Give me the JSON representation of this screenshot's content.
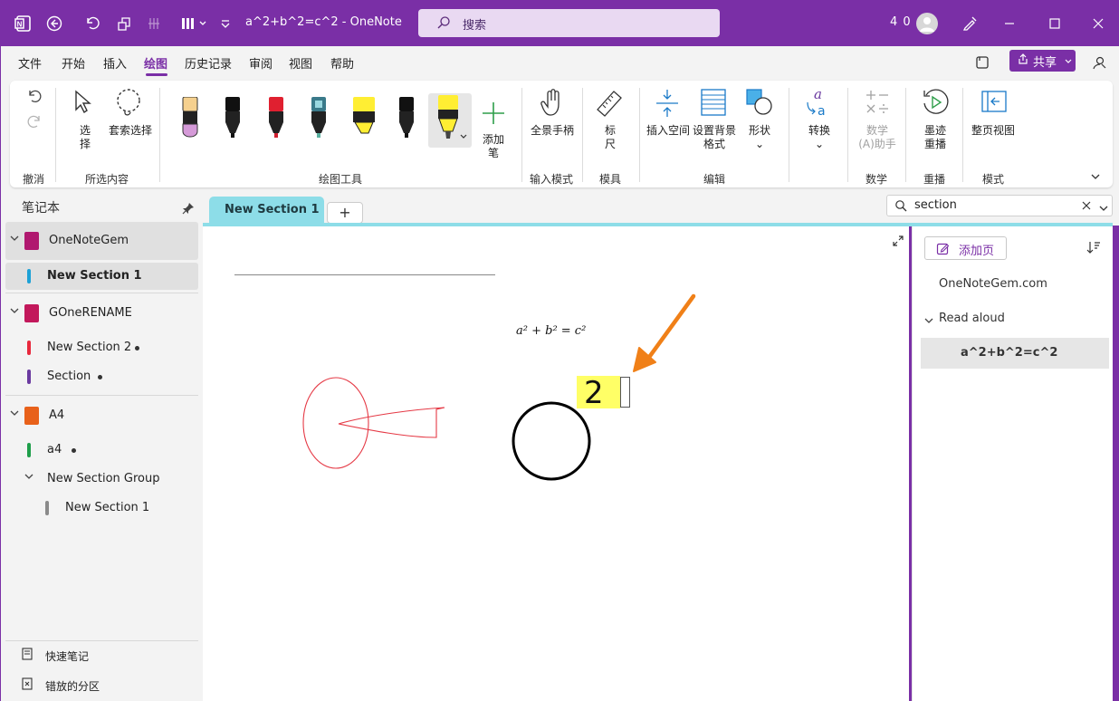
{
  "titlebar": {
    "doc_title": "a^2+b^2=c^2  -  OneNote",
    "search_placeholder": "搜索",
    "user_initials": "4 0"
  },
  "menu": {
    "items": [
      "文件",
      "开始",
      "插入",
      "绘图",
      "历史记录",
      "审阅",
      "视图",
      "帮助"
    ],
    "active": "绘图",
    "share_label": "共享"
  },
  "ribbon": {
    "undo_group": "撤消",
    "select_label": "选\n择",
    "lasso_label": "套索选择",
    "selection_group": "所选内容",
    "add_pen_label": "添加\n笔",
    "drawing_tools_group": "绘图工具",
    "hand_label": "全景手柄",
    "input_mode_group": "输入模式",
    "ruler_label": "标\n尺",
    "stencil_group": "模具",
    "insert_space_label": "插入空间",
    "bg_format_label": "设置背景\n格式",
    "shapes_label": "形状",
    "edit_group": "编辑",
    "convert_label": "转换",
    "math_assistant_label": "数学\n(A)助手",
    "math_group": "数学",
    "replay_label": "墨迹\n重播",
    "replay_group": "重播",
    "fullpage_label": "整页视图",
    "mode_group": "模式"
  },
  "sidebar": {
    "title": "笔记本",
    "notebooks": [
      {
        "name": "OneNoteGem",
        "color": "#b0186f"
      },
      {
        "name": "GOneRENAME",
        "color": "#c2185b"
      },
      {
        "name": "A4",
        "color": "#e8611a"
      }
    ],
    "sections": [
      {
        "name": "New Section 1",
        "color": "#1da1d6"
      },
      {
        "name": "New Section 2",
        "color": "#e8283c"
      },
      {
        "name": "Section",
        "color": "#6a3aa0"
      },
      {
        "name": "a4",
        "color": "#1e9e4a"
      },
      {
        "name": "New Section Group",
        "color": ""
      },
      {
        "name": "New Section 1",
        "color": "#8a8a8a"
      }
    ],
    "quick_notes": "快速笔记",
    "misplaced": "错放的分区"
  },
  "tabs": {
    "current": "New Section 1",
    "add": "+"
  },
  "page_search": {
    "value": "section"
  },
  "canvas": {
    "equation": "a² + b² = c²",
    "handwritten": "2"
  },
  "pagelist": {
    "add_page": "添加页",
    "pages": [
      "OneNoteGem.com",
      "Read aloud",
      "a^2+b^2=c^2"
    ]
  },
  "colors": {
    "accent": "#7a2fa6",
    "tab": "#8ddde8",
    "highlight": "#ffff66",
    "arrow": "#f08018",
    "ink_red": "#e53945"
  }
}
